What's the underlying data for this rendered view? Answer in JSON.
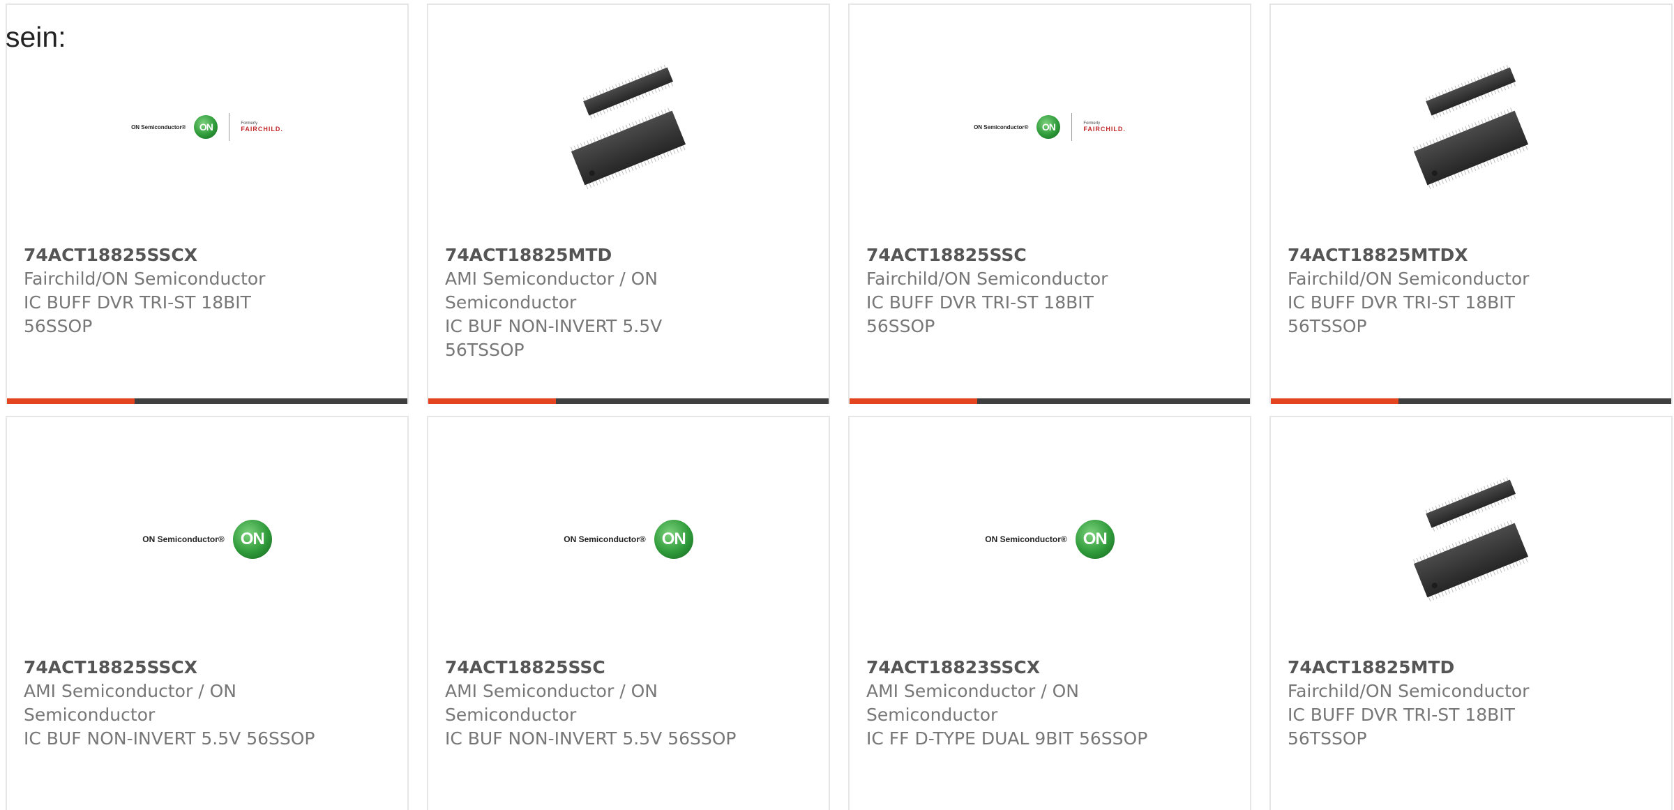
{
  "intro_text": "sein:",
  "brand": {
    "on_semiconductor_text": "ON Semiconductor®",
    "on_letters": "ON",
    "formerly": "Formerly",
    "fairchild": "FAIRCHILD."
  },
  "colors": {
    "accent": "#e2451f",
    "bar": "#3f3f3f",
    "text": "#777777",
    "part_number": "#555555"
  },
  "cards": [
    {
      "part_number": "74ACT18825SSCX",
      "manufacturer": "Fairchild/ON Semiconductor",
      "description": "IC BUFF DVR TRI-ST 18BIT 56SSOP",
      "image": "on-fairchild-logo"
    },
    {
      "part_number": "74ACT18825MTD",
      "manufacturer": "AMI Semiconductor / ON Semiconductor",
      "description": "IC BUF NON-INVERT 5.5V 56TSSOP",
      "image": "tssop-chip-photo"
    },
    {
      "part_number": "74ACT18825SSC",
      "manufacturer": "Fairchild/ON Semiconductor",
      "description": "IC BUFF DVR TRI-ST 18BIT 56SSOP",
      "image": "on-fairchild-logo"
    },
    {
      "part_number": "74ACT18825MTDX",
      "manufacturer": "Fairchild/ON Semiconductor",
      "description": "IC BUFF DVR TRI-ST 18BIT 56TSSOP",
      "image": "tssop-chip-photo"
    },
    {
      "part_number": "74ACT18825SSCX",
      "manufacturer": "AMI Semiconductor / ON Semiconductor",
      "description": "IC BUF NON-INVERT 5.5V 56SSOP",
      "image": "on-semiconductor-logo"
    },
    {
      "part_number": "74ACT18825SSC",
      "manufacturer": "AMI Semiconductor / ON Semiconductor",
      "description": "IC BUF NON-INVERT 5.5V 56SSOP",
      "image": "on-semiconductor-logo"
    },
    {
      "part_number": "74ACT18823SSCX",
      "manufacturer": "AMI Semiconductor / ON Semiconductor",
      "description": "IC FF D-TYPE DUAL 9BIT 56SSOP",
      "image": "on-semiconductor-logo"
    },
    {
      "part_number": "74ACT18825MTD",
      "manufacturer": "Fairchild/ON Semiconductor",
      "description": "IC BUFF DVR TRI-ST 18BIT 56TSSOP",
      "image": "tssop-chip-photo"
    }
  ]
}
